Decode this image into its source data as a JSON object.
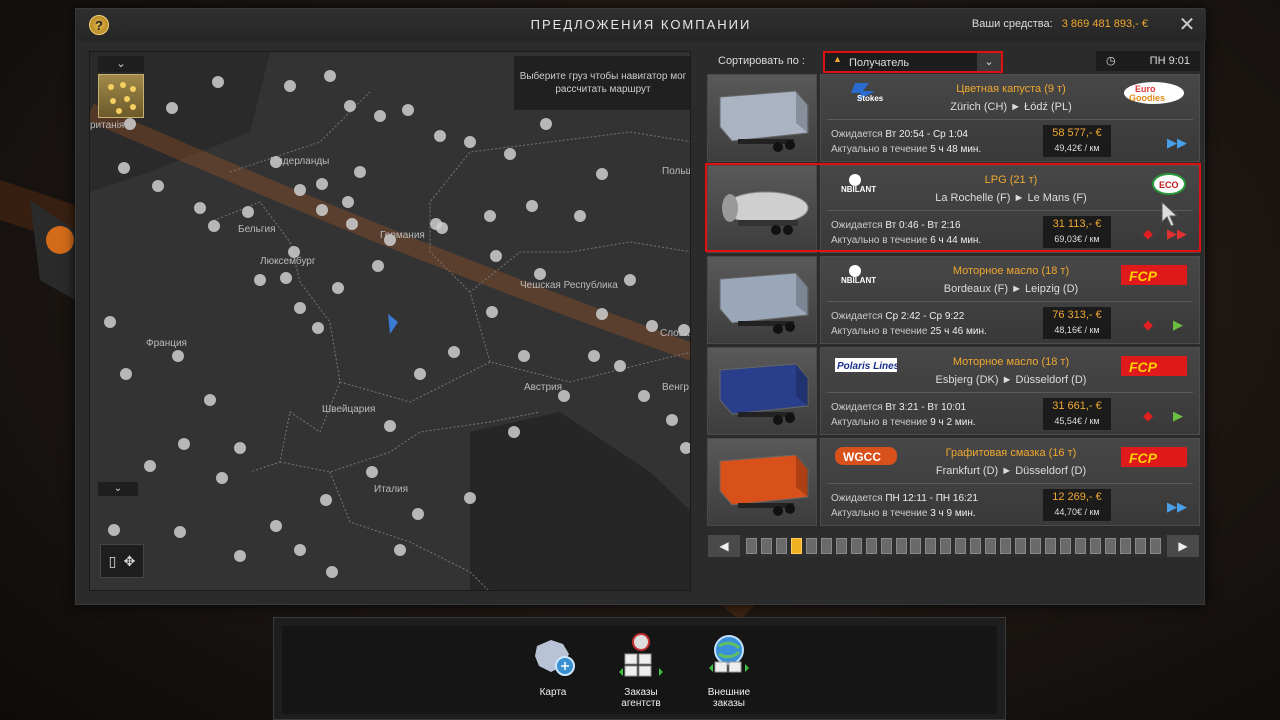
{
  "window": {
    "title": "ПРЕДЛОЖЕНИЯ КОМПАНИИ",
    "funds_label": "Ваши средства:",
    "funds_value": "3 869 481 893,- €"
  },
  "map": {
    "hint": "Выберите груз чтобы навигатор мог рассчитать маршрут",
    "labels": [
      "ританія",
      "Нидерланды",
      "Бельгия",
      "Люксембург",
      "Германия",
      "Франция",
      "Чешская Республика",
      "Швейцария",
      "Австрия",
      "Италия",
      "Польш",
      "Словак",
      "Венгр"
    ]
  },
  "sort": {
    "label": "Сортировать по :",
    "value": "Получатель"
  },
  "clock": {
    "time": "ПН 9:01"
  },
  "offers": [
    {
      "company": "Stokes",
      "client": "Euro Goodies",
      "cargo": "Цветная капуста (9 т)",
      "route_from": "Zürich (CH)",
      "route_to": "Łódź (PL)",
      "expected_label": "Ожидается",
      "expected": "Вт 20:54 - Ср 1:04",
      "valid_label": "Актуально в течение",
      "valid": "5 ч 48 мин.",
      "price": "58 577,- €",
      "rate": "49,42€ / км",
      "trailer_color": "#a9b3c2",
      "action": "fast"
    },
    {
      "company": "NBILANT",
      "client": "ECO",
      "cargo": "LPG (21 т)",
      "route_from": "La Rochelle (F)",
      "route_to": "Le Mans (F)",
      "expected_label": "Ожидается",
      "expected": "Вт 0:46 - Вт 2:16",
      "valid_label": "Актуально в течение",
      "valid": "6 ч 44 мин.",
      "price": "31 113,- €",
      "rate": "69,03€ / км",
      "trailer_color": "#b8b8b8",
      "action": "hazard-fast"
    },
    {
      "company": "NBILANT",
      "client": "FCP",
      "cargo": "Моторное масло (18 т)",
      "route_from": "Bordeaux (F)",
      "route_to": "Leipzig (D)",
      "expected_label": "Ожидается",
      "expected": "Ср 2:42 - Ср 9:22",
      "valid_label": "Актуально в течение",
      "valid": "25 ч 46 мин.",
      "price": "76 313,- €",
      "rate": "48,16€ / км",
      "trailer_color": "#9aa7b8",
      "action": "hazard-normal"
    },
    {
      "company": "Polaris Lines",
      "client": "FCP",
      "cargo": "Моторное масло (18 т)",
      "route_from": "Esbjerg (DK)",
      "route_to": "Düsseldorf (D)",
      "expected_label": "Ожидается",
      "expected": "Вт 3:21 - Вт 10:01",
      "valid_label": "Актуально в течение",
      "valid": "9 ч 2 мин.",
      "price": "31 661,- €",
      "rate": "45,54€ / км",
      "trailer_color": "#2a3f8c",
      "action": "hazard-normal"
    },
    {
      "company": "WGCC",
      "client": "FCP",
      "cargo": "Графитовая смазка (16 т)",
      "route_from": "Frankfurt (D)",
      "route_to": "Düsseldorf (D)",
      "expected_label": "Ожидается",
      "expected": "ПН 12:11 - ПН 16:21",
      "valid_label": "Актуально в течение",
      "valid": "3 ч 9 мин.",
      "price": "12 269,- €",
      "rate": "44,70€ / км",
      "trailer_color": "#d8501a",
      "action": "fast"
    }
  ],
  "pager": {
    "active_page": 4,
    "pages": 28
  },
  "dock": [
    {
      "label": "Карта",
      "icon": "europe-map-icon"
    },
    {
      "label": "Заказы агентств",
      "icon": "agency-orders-icon"
    },
    {
      "label": "Внешние заказы",
      "icon": "external-orders-icon"
    }
  ]
}
